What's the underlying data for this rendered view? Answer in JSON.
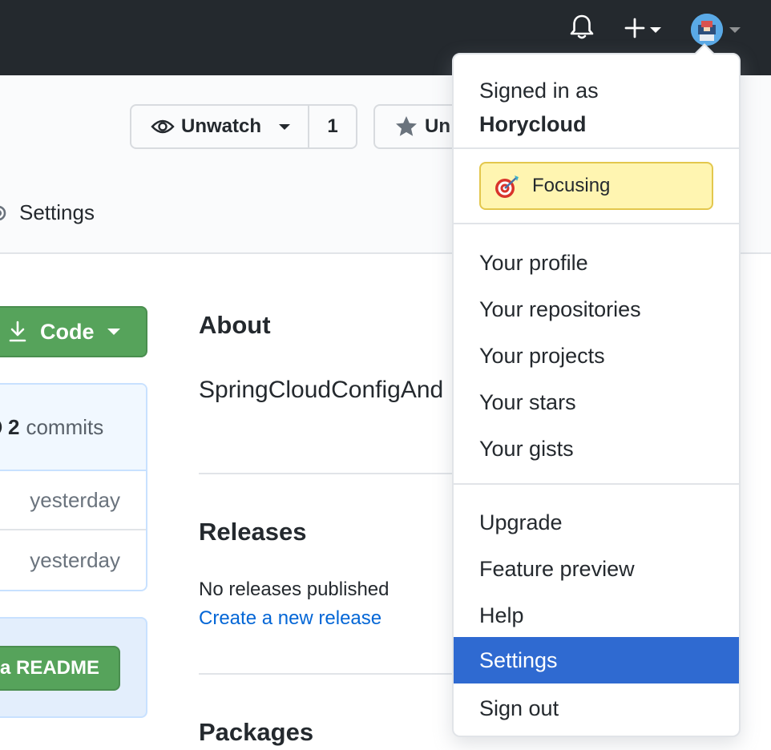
{
  "header": {
    "icons": [
      "bell-icon",
      "plus-icon",
      "avatar"
    ]
  },
  "repo": {
    "watch_label": "Unwatch",
    "watch_count": "1",
    "star_label": "Un",
    "settings_tab_label": "Settings"
  },
  "code": {
    "button_label": "Code"
  },
  "commits": {
    "count": "2",
    "label": "commits",
    "rows": [
      "yesterday",
      "yesterday"
    ]
  },
  "readme": {
    "button_label": "a README"
  },
  "about": {
    "title": "About",
    "description": "SpringCloudConfigAnd"
  },
  "releases": {
    "title": "Releases",
    "empty_text": "No releases published",
    "create_link": "Create a new release"
  },
  "packages": {
    "title": "Packages"
  },
  "dropdown": {
    "signed_in_as": "Signed in as",
    "username": "Horycloud",
    "status_label": "Focusing",
    "status_emoji": "dart-icon",
    "items_group1": [
      "Your profile",
      "Your repositories",
      "Your projects",
      "Your stars",
      "Your gists"
    ],
    "items_group2": [
      "Upgrade",
      "Feature preview",
      "Help",
      "Settings",
      "Sign out"
    ],
    "active_item": "Settings"
  },
  "colors": {
    "topbar": "#24292e",
    "primary_green": "#56a35b",
    "link_blue": "#0366d6",
    "active_blue": "#2f6ad1",
    "status_yellow": "#fff5b1"
  }
}
